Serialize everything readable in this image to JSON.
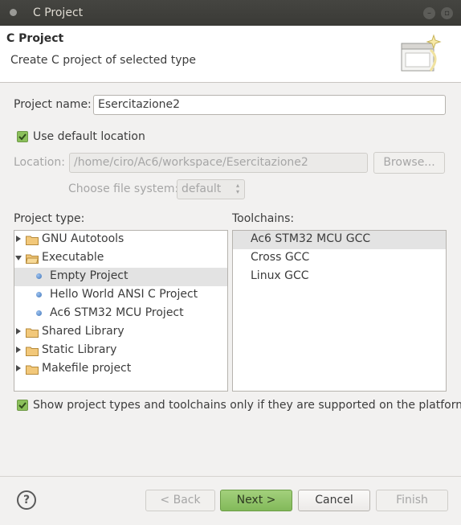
{
  "window": {
    "title": "C Project"
  },
  "header": {
    "title": "C Project",
    "description": "Create C project of selected type"
  },
  "project_name": {
    "label": "Project name:",
    "value": "Esercitazione2"
  },
  "use_default_location": {
    "label": "Use default location",
    "checked": true
  },
  "location": {
    "label": "Location:",
    "value": "/home/ciro/Ac6/workspace/Esercitazione2",
    "browse_label": "Browse..."
  },
  "file_system": {
    "label": "Choose file system:",
    "value": "default"
  },
  "project_type": {
    "label": "Project type:",
    "items": [
      {
        "label": "GNU Autotools"
      },
      {
        "label": "Executable"
      },
      {
        "label": "Empty Project"
      },
      {
        "label": "Hello World ANSI C Project"
      },
      {
        "label": "Ac6 STM32 MCU Project"
      },
      {
        "label": "Shared Library"
      },
      {
        "label": "Static Library"
      },
      {
        "label": "Makefile project"
      }
    ]
  },
  "toolchains": {
    "label": "Toolchains:",
    "items": [
      {
        "label": "Ac6 STM32 MCU GCC"
      },
      {
        "label": "Cross GCC"
      },
      {
        "label": "Linux GCC"
      }
    ]
  },
  "show_supported": {
    "label": "Show project types and toolchains only if they are supported on the platform",
    "checked": true
  },
  "footer": {
    "help_symbol": "?",
    "back_label": "< Back",
    "next_label": "Next >",
    "cancel_label": "Cancel",
    "finish_label": "Finish"
  },
  "colors": {
    "accent": "#8bc05b",
    "selection": "#e3e3e3",
    "titlebar": "#3c3b37"
  }
}
